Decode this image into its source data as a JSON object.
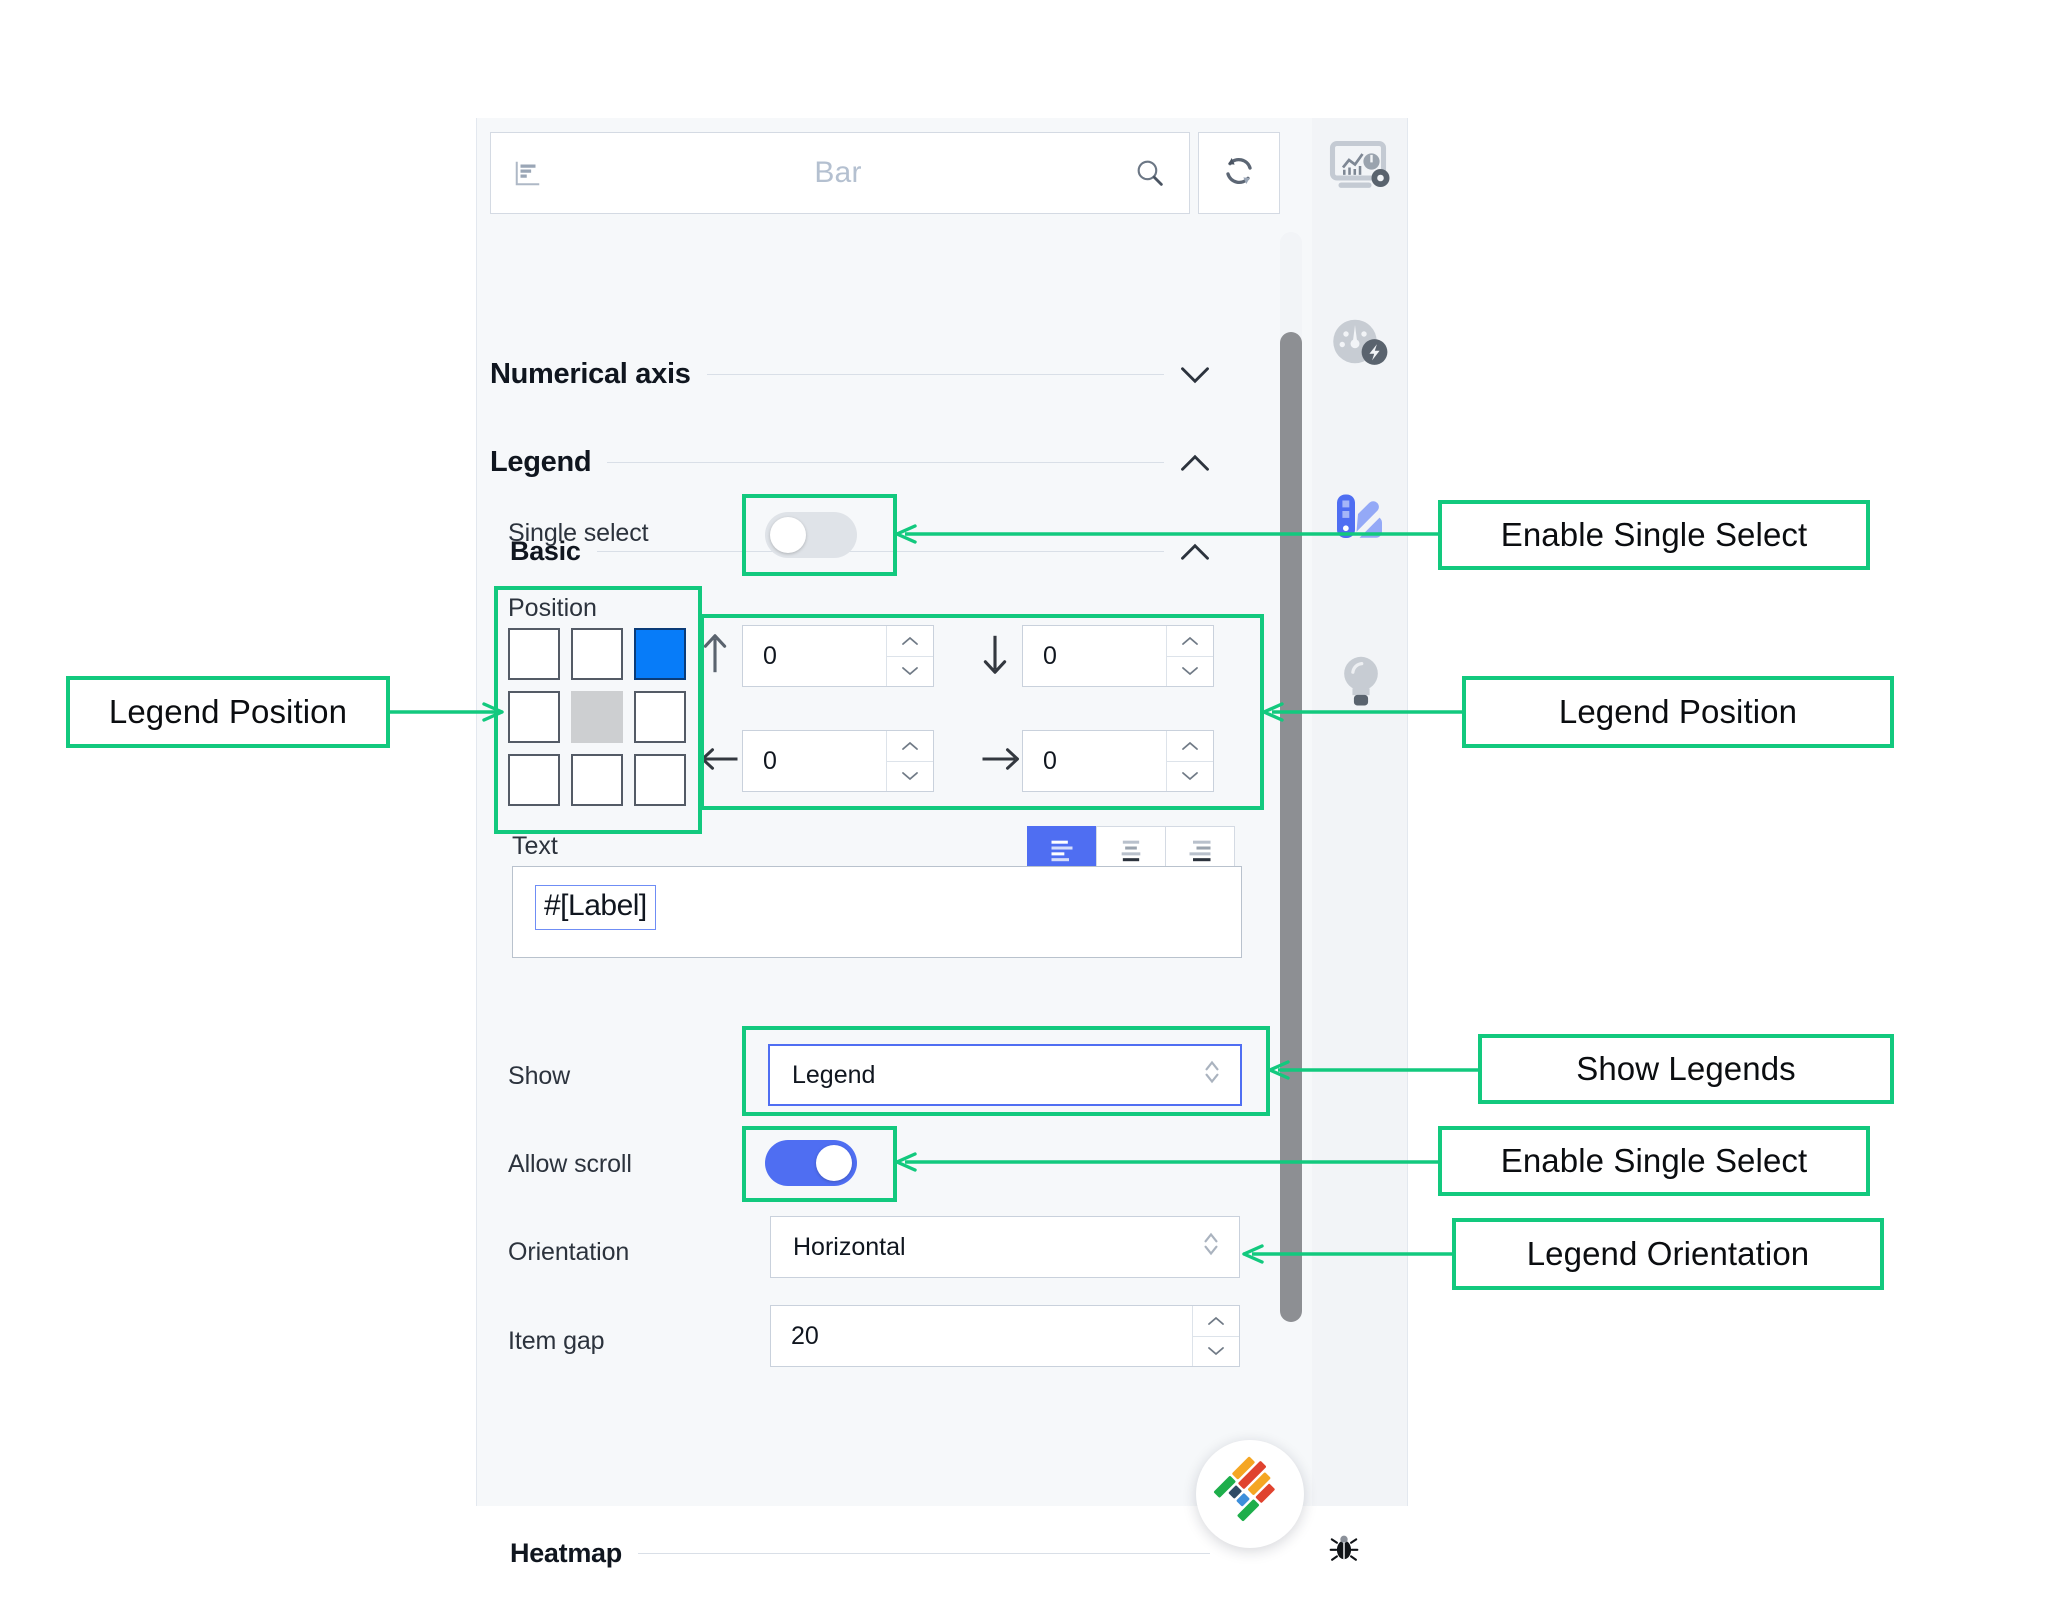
{
  "panel": {
    "search": {
      "placeholder": "Bar",
      "chart_icon": "bar-chart-icon",
      "search_icon": "search-icon",
      "refresh_icon": "refresh-icon"
    },
    "sections": [
      {
        "title": "Numerical axis",
        "state": "collapsed",
        "chevron": "chevron-down-icon"
      },
      {
        "title": "Legend",
        "state": "expanded",
        "chevron": "chevron-up-icon"
      },
      {
        "title": "Basic",
        "state": "expanded",
        "chevron": "chevron-up-icon"
      },
      {
        "title": "Heatmap",
        "state": "collapsed",
        "chevron": "chevron-down-icon"
      }
    ],
    "single_select": {
      "label": "Single select",
      "value": "off"
    },
    "position": {
      "label": "Position",
      "cells": [
        "empty",
        "empty",
        "selected",
        "empty",
        "center",
        "empty",
        "empty",
        "empty",
        "empty"
      ],
      "selected_index": 2,
      "offsets": [
        {
          "icon": "arrow-up-icon",
          "value": "0"
        },
        {
          "icon": "arrow-down-icon",
          "value": "0"
        },
        {
          "icon": "arrow-left-icon",
          "value": "0"
        },
        {
          "icon": "arrow-right-icon",
          "value": "0"
        }
      ]
    },
    "text": {
      "label": "Text",
      "value": "#[Label]",
      "align_options": [
        "align-left-icon",
        "align-center-icon",
        "align-right-icon"
      ],
      "align_active": 0
    },
    "show": {
      "label": "Show",
      "value": "Legend"
    },
    "allow_scroll": {
      "label": "Allow scroll",
      "value": "on"
    },
    "orientation": {
      "label": "Orientation",
      "value": "Horizontal"
    },
    "item_gap": {
      "label": "Item gap",
      "value": "20"
    }
  },
  "rail": {
    "items": [
      {
        "icon": "chart-settings-icon",
        "active": false
      },
      {
        "icon": "gauge-performance-icon",
        "active": false
      },
      {
        "icon": "color-palette-icon",
        "active": true
      },
      {
        "icon": "lightbulb-icon",
        "active": false
      }
    ]
  },
  "branding": {
    "logo": "woven-chevron-logo",
    "bug": "bug-icon"
  },
  "annotations": [
    {
      "id": "a1",
      "text": "Enable Single Select"
    },
    {
      "id": "a2",
      "text": "Legend Position"
    },
    {
      "id": "a3",
      "text": "Legend Position"
    },
    {
      "id": "a4",
      "text": "Show Legends"
    },
    {
      "id": "a5",
      "text": "Enable Single Select"
    },
    {
      "id": "a6",
      "text": "Legend Orientation"
    }
  ],
  "colors": {
    "accent_blue": "#4f6ef2",
    "selected_cell": "#077cf9",
    "annotation_green": "#12c97e",
    "panel_bg": "#f6f8fa"
  }
}
